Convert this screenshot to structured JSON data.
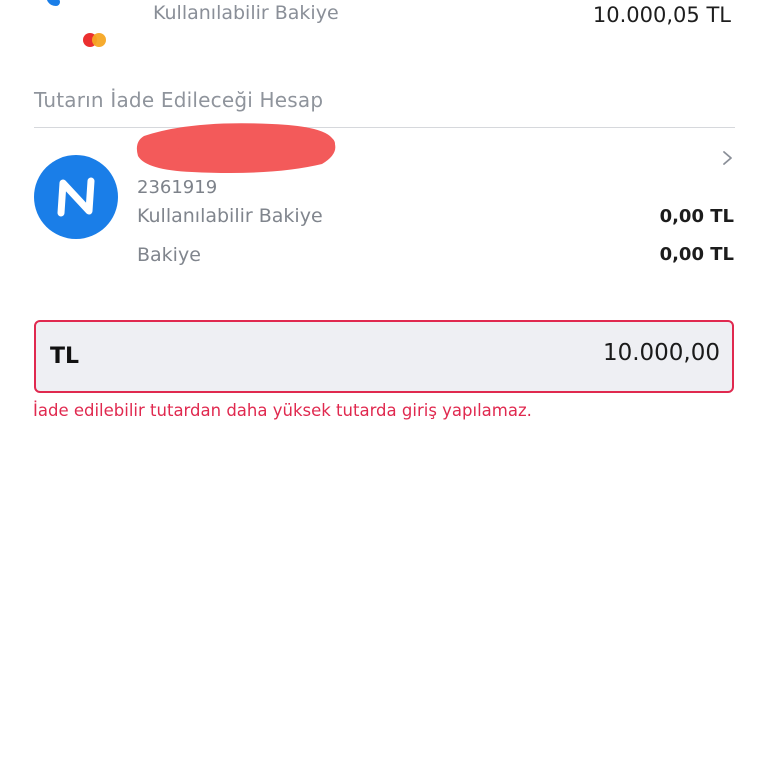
{
  "source_balance": {
    "label": "Kullanılabilir Bakiye",
    "amount": "10.000,05 TL",
    "logo_icon": "brand-logo-icon",
    "card_icon": "mastercard-icon"
  },
  "section_title": "Tutarın İade Edileceği Hesap",
  "account": {
    "avatar_icon": "n-logo-icon",
    "name_redacted": true,
    "account_number": "2361919",
    "rows": [
      {
        "label": "Kullanılabilir Bakiye",
        "value": "0,00 TL"
      },
      {
        "label": "Bakiye",
        "value": "0,00 TL"
      }
    ],
    "chevron_icon": "chevron-right-icon"
  },
  "amount_input": {
    "currency": "TL",
    "value": "10.000,00"
  },
  "error_message": "İade edilebilir tutardan daha yüksek tutarda giriş yapılamaz.",
  "colors": {
    "accent_blue": "#1a7ee8",
    "error_red": "#e0294f",
    "redaction": "#f35a5a",
    "input_bg": "#eeeff3"
  }
}
